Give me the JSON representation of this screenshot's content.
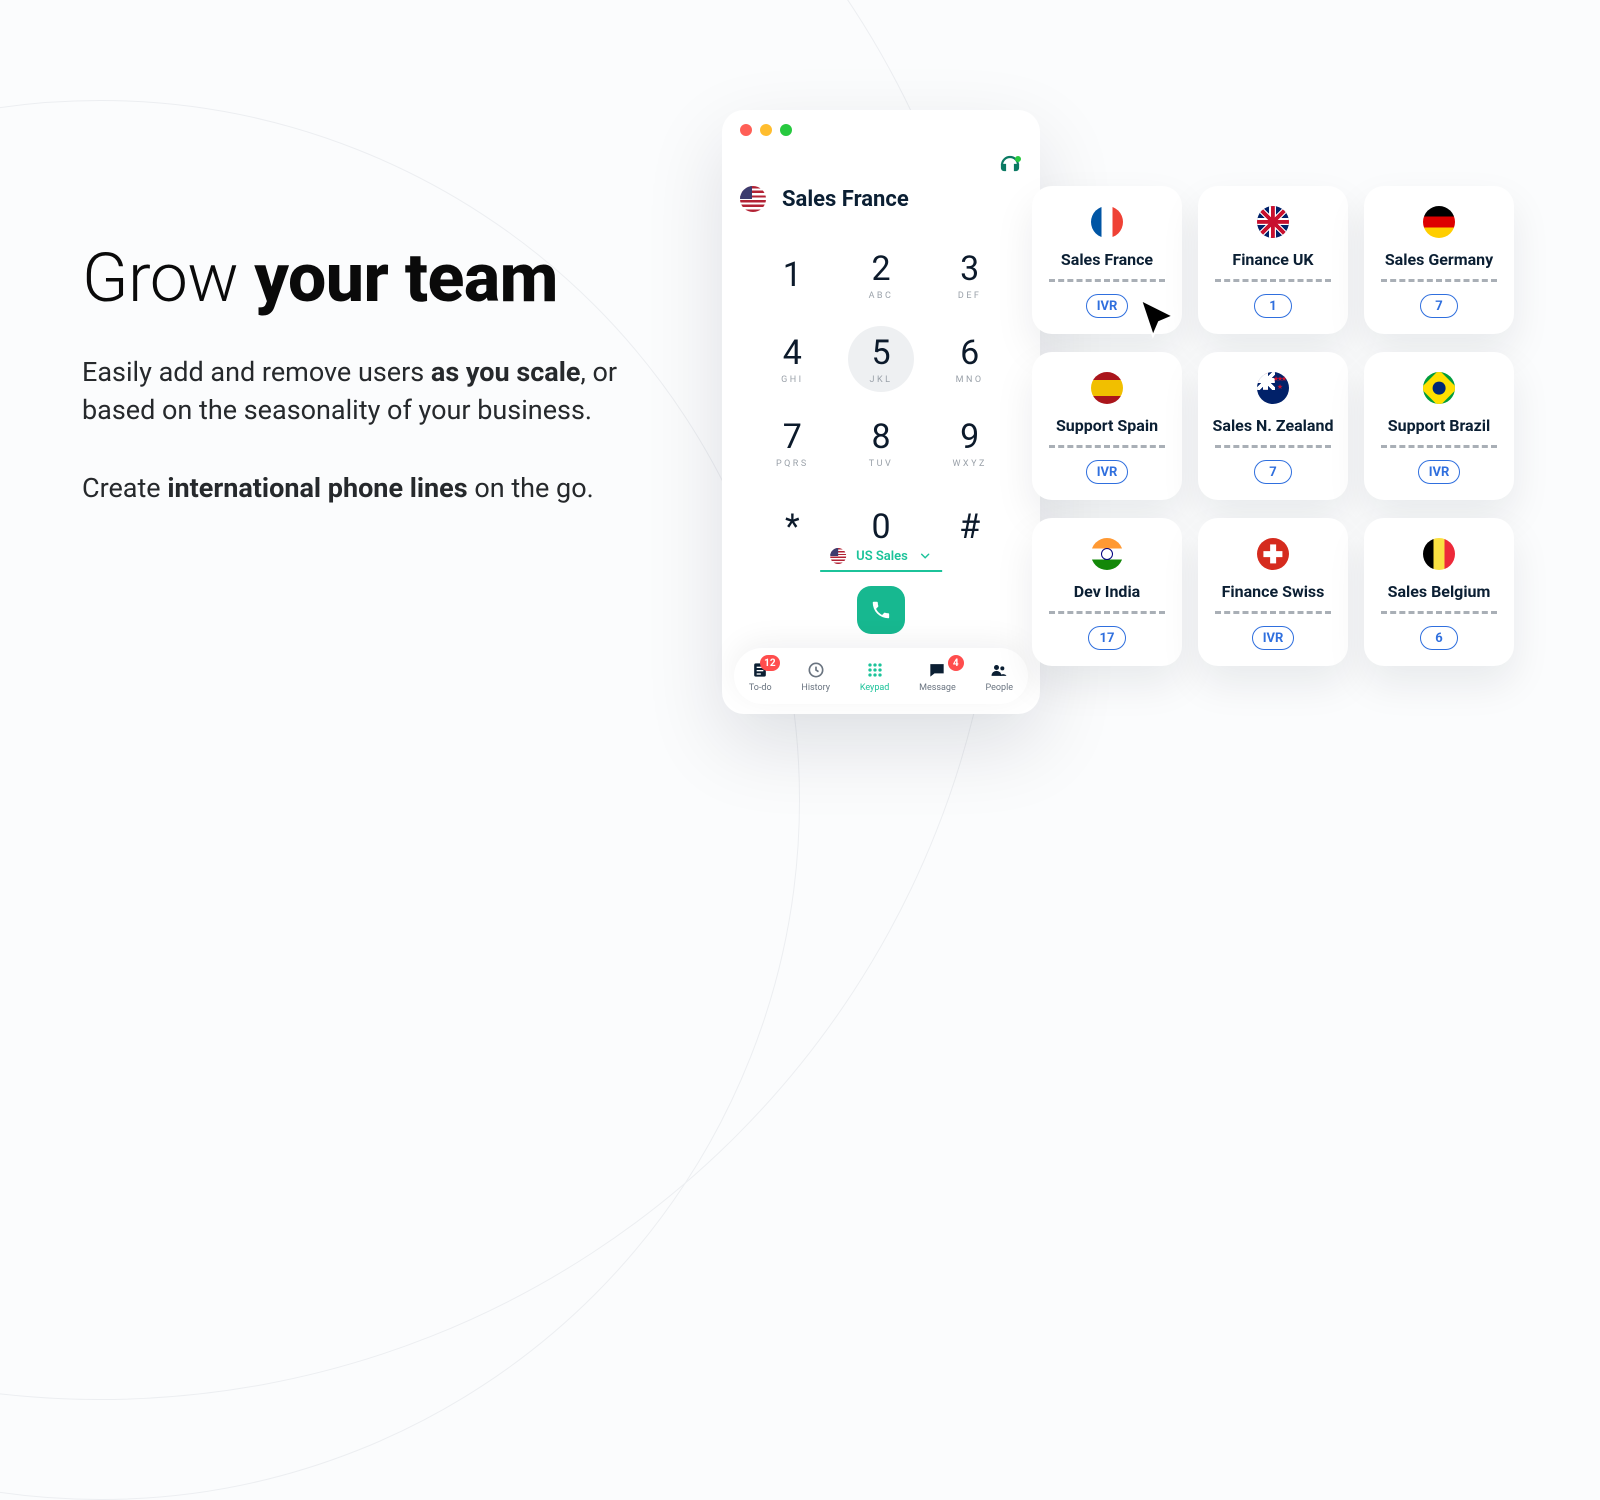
{
  "copy": {
    "headline_pre": "Grow ",
    "headline_bold": "your team",
    "p1_pre": "Easily add and remove users ",
    "p1_bold": "as you scale",
    "p1_post": ", or based on the seasonality of your business.",
    "p2_pre": "Create ",
    "p2_bold": "international phone lines",
    "p2_post": " on the go."
  },
  "phone": {
    "channel": "Sales France",
    "keys": [
      {
        "num": "1",
        "sub": ""
      },
      {
        "num": "2",
        "sub": "ABC"
      },
      {
        "num": "3",
        "sub": "DEF"
      },
      {
        "num": "4",
        "sub": "GHI"
      },
      {
        "num": "5",
        "sub": "JKL",
        "pressed": true
      },
      {
        "num": "6",
        "sub": "MNO"
      },
      {
        "num": "7",
        "sub": "PQRS"
      },
      {
        "num": "8",
        "sub": "TUV"
      },
      {
        "num": "9",
        "sub": "WXYZ"
      },
      {
        "num": "*",
        "sub": ""
      },
      {
        "num": "0",
        "sub": ""
      },
      {
        "num": "#",
        "sub": ""
      }
    ],
    "line_selected": "US Sales",
    "tabs": [
      {
        "id": "todo",
        "label": "To-do",
        "badge": "12"
      },
      {
        "id": "history",
        "label": "History"
      },
      {
        "id": "keypad",
        "label": "Keypad",
        "active": true
      },
      {
        "id": "message",
        "label": "Message",
        "badge": "4"
      },
      {
        "id": "people",
        "label": "People"
      }
    ]
  },
  "cards": [
    {
      "name": "Sales France",
      "flag": "fr",
      "pill": "IVR"
    },
    {
      "name": "Finance UK",
      "flag": "uk",
      "pill": "1"
    },
    {
      "name": "Sales Germany",
      "flag": "de",
      "pill": "7"
    },
    {
      "name": "Support Spain",
      "flag": "es",
      "pill": "IVR"
    },
    {
      "name": "Sales N. Zealand",
      "flag": "nz",
      "pill": "7"
    },
    {
      "name": "Support Brazil",
      "flag": "br",
      "pill": "IVR"
    },
    {
      "name": "Dev India",
      "flag": "in",
      "pill": "17"
    },
    {
      "name": "Finance Swiss",
      "flag": "ch",
      "pill": "IVR"
    },
    {
      "name": "Sales Belgium",
      "flag": "be",
      "pill": "6"
    }
  ]
}
